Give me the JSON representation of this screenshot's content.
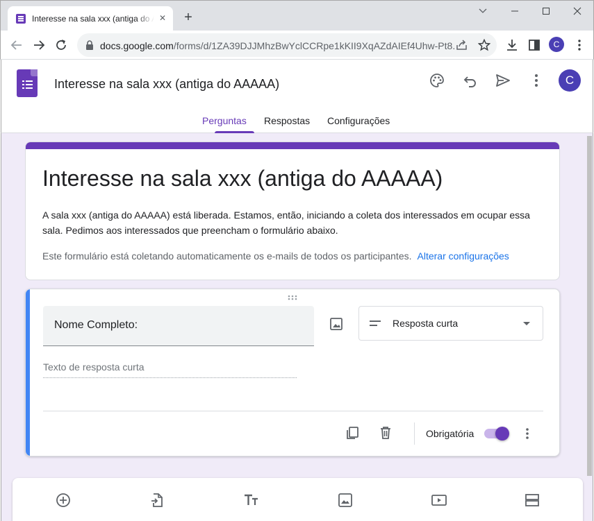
{
  "browser": {
    "tab_title": "Interesse na sala xxx (antiga do AAAAA)",
    "url_host": "docs.google.com",
    "url_path": "/forms/d/1ZA39DJJMhzBwYclCCRpe1kKII9XqAZdAIEf4Uhw-Pt8...",
    "profile_initial": "C"
  },
  "header": {
    "doc_title": "Interesse na sala xxx (antiga do AAAAA)",
    "avatar_initial": "C",
    "tabs": [
      {
        "label": "Perguntas",
        "active": true
      },
      {
        "label": "Respostas",
        "active": false
      },
      {
        "label": "Configurações",
        "active": false
      }
    ]
  },
  "form": {
    "title": "Interesse na sala xxx (antiga do AAAAA)",
    "description": "A sala xxx (antiga do AAAAA) está liberada. Estamos, então, iniciando a coleta dos interessados em ocupar essa sala. Pedimos aos interessados que preencham o formulário abaixo.",
    "collect_note": "Este formulário está coletando automaticamente os e-mails de todos os participantes.",
    "collect_link": "Alterar configurações"
  },
  "question": {
    "title": "Nome Completo:",
    "type_label": "Resposta curta",
    "answer_placeholder": "Texto de resposta curta",
    "required_label": "Obrigatória",
    "required": true
  },
  "colors": {
    "theme": "#673ab7",
    "background": "#f0ebf8",
    "focus_bar": "#4285f4",
    "link": "#1a73e8"
  }
}
